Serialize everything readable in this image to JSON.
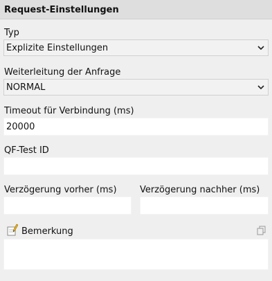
{
  "header": {
    "title": "Request-Einstellungen"
  },
  "typ": {
    "label": "Typ",
    "value": "Explizite Einstellungen",
    "icon": "chevron-down-icon"
  },
  "weiterleitung": {
    "label": "Weiterleitung der Anfrage",
    "value": "NORMAL",
    "icon": "chevron-down-icon"
  },
  "timeout": {
    "label": "Timeout für Verbindung (ms)",
    "value": "20000"
  },
  "qftest_id": {
    "label": "QF-Test ID",
    "value": ""
  },
  "verzoegerung_vorher": {
    "label": "Verzögerung vorher (ms)",
    "value": ""
  },
  "verzoegerung_nachher": {
    "label": "Verzögerung nachher (ms)",
    "value": ""
  },
  "bemerkung": {
    "label": "Bemerkung",
    "value": "",
    "icons": [
      "note-pencil-icon",
      "copy-icon"
    ]
  }
}
